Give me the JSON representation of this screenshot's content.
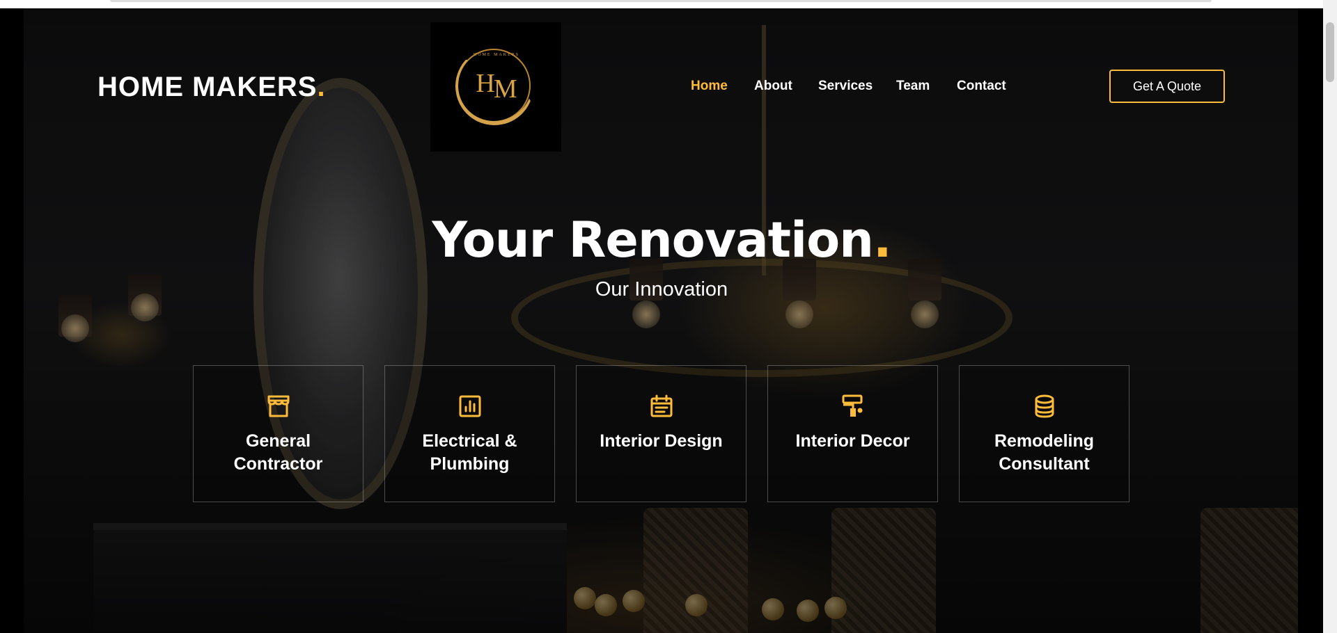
{
  "brand": {
    "name": "HOME MAKERS",
    "dot": "."
  },
  "logo": {
    "letters_h": "H",
    "letters_m": "M",
    "ring_text": "HOME MAKERS"
  },
  "nav": {
    "items": [
      {
        "label": "Home",
        "active": true
      },
      {
        "label": "About",
        "active": false
      },
      {
        "label": "Services",
        "active": false
      },
      {
        "label": "Team",
        "active": false
      },
      {
        "label": "Contact",
        "active": false
      }
    ]
  },
  "cta": {
    "label": "Get A Quote"
  },
  "hero": {
    "title": "Your Renovation",
    "title_dot": ".",
    "subtitle": "Our Innovation"
  },
  "services": [
    {
      "label": "General Contractor",
      "icon": "storefront-icon"
    },
    {
      "label": "Electrical & Plumbing",
      "icon": "bar-chart-icon"
    },
    {
      "label": "Interior Design",
      "icon": "calendar-icon"
    },
    {
      "label": "Interior Decor",
      "icon": "paint-roller-icon"
    },
    {
      "label": "Remodeling Consultant",
      "icon": "database-icon"
    }
  ],
  "colors": {
    "accent": "#ffbc3b",
    "text": "#ffffff",
    "background": "#000000"
  }
}
